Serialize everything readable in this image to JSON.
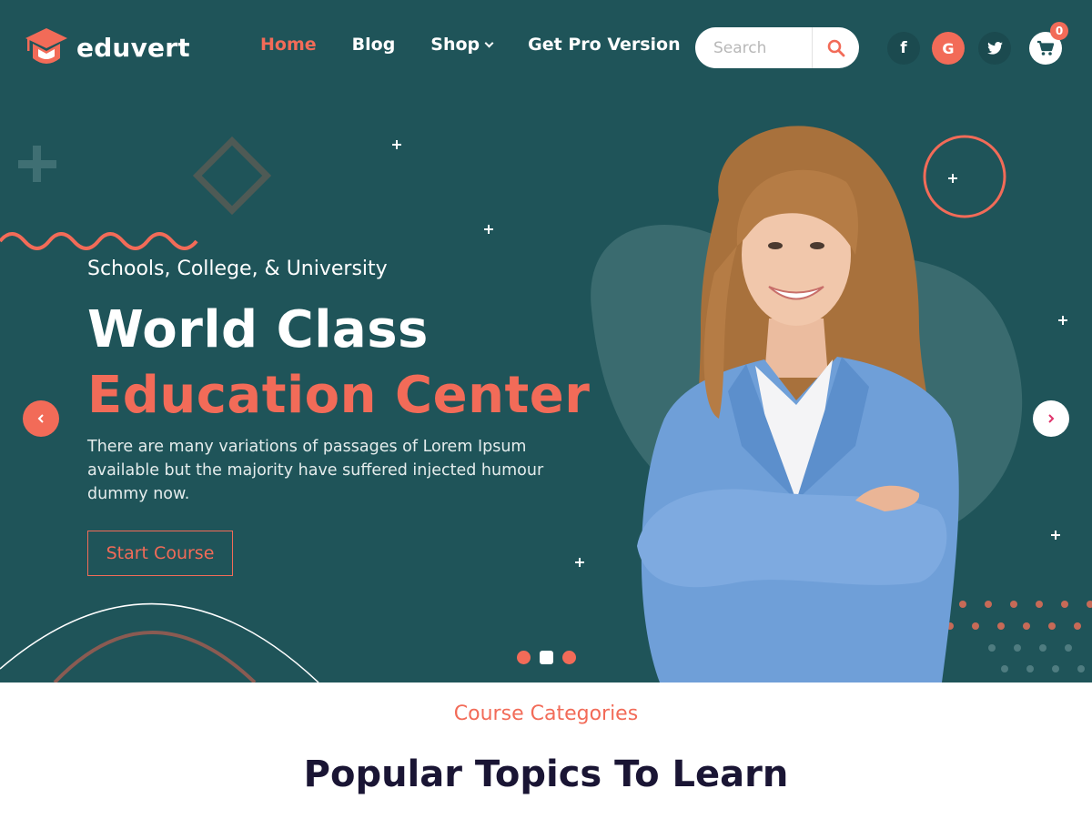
{
  "brand": {
    "name": "eduvert",
    "accent": "#f26b58",
    "hero_bg": "#1f5459"
  },
  "nav": {
    "items": [
      {
        "label": "Home",
        "active": true
      },
      {
        "label": "Blog",
        "active": false
      },
      {
        "label": "Shop",
        "active": false,
        "has_dropdown": true
      },
      {
        "label": "Get Pro Version",
        "active": false
      }
    ]
  },
  "search": {
    "placeholder": "Search",
    "icon": "search-icon"
  },
  "social": {
    "facebook_icon": "f",
    "google_icon": "G",
    "twitter_icon": "twitter-icon"
  },
  "cart": {
    "count": "0",
    "icon": "cart-icon"
  },
  "hero": {
    "kicker": "Schools, College, & University",
    "headline_line1": "World Class",
    "headline_line2": "Education Center",
    "description": "There are many variations of passages of Lorem Ipsum available but the majority have suffered injected humour dummy now.",
    "cta_label": "Start Course",
    "prev_icon": "chevron-left-icon",
    "next_icon": "chevron-right-icon",
    "slides": {
      "count": 3,
      "active_index": 1
    },
    "image": "smiling woman in blue blazer with arms crossed"
  },
  "section": {
    "kicker": "Course Categories",
    "title": "Popular Topics To Learn"
  }
}
